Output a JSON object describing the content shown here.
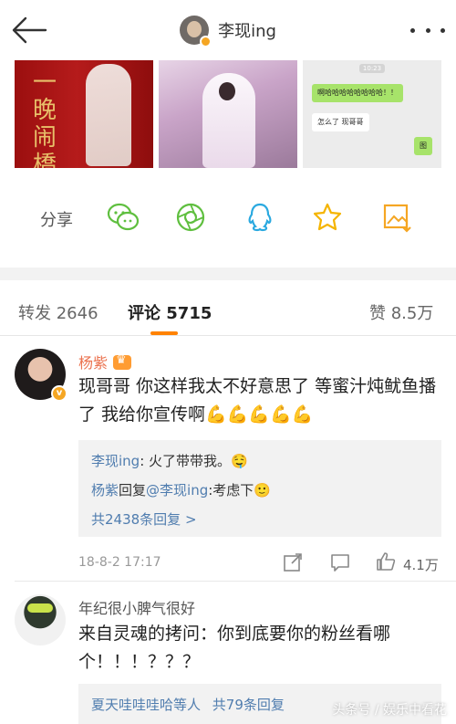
{
  "header": {
    "title": "李现ing",
    "back_icon": "back-arrow-icon",
    "more_icon": "more-dots-icon"
  },
  "images": {
    "pic1_calligraphy": "一晚闹橋",
    "pic3": {
      "time": "10:23",
      "msg1": "啊哈哈哈哈哈哈哈哈！！",
      "msg2": "怎么了 现哥哥",
      "msg3": "图"
    }
  },
  "share": {
    "label": "分享",
    "icons": [
      "wechat-icon",
      "moments-icon",
      "qq-icon",
      "qzone-star-icon",
      "save-image-icon"
    ]
  },
  "tabs": {
    "repost": "转发 2646",
    "comments": "评论 5715",
    "likes": "赞 8.5万",
    "accent": "#ff8200"
  },
  "comments": [
    {
      "name": "杨紫",
      "text": "现哥哥 你这样我太不好意思了 等蜜汁炖鱿鱼播了 我给你宣传啊💪💪💪💪💪",
      "replies": [
        {
          "user": "李现ing",
          "content": ": 火了带带我。🤤"
        },
        {
          "user": "杨紫",
          "mid": "回复",
          "at": "@李现ing",
          "content": ":考虑下🙂"
        }
      ],
      "more_replies": "共2438条回复 >",
      "time": "18-8-2 17:17",
      "likes": "4.1万"
    },
    {
      "name": "年纪很小脾气很好",
      "text": "来自灵魂的拷问：你到底要你的粉丝看哪个！！！？？？",
      "reply_summary_user": "夏天哇哇哇哈等人",
      "reply_summary_count": "共79条回复"
    }
  ],
  "watermark": "头条号 / 娱乐中看花",
  "colors": {
    "name_orange": "#eb7350",
    "link_blue": "#507daf"
  }
}
